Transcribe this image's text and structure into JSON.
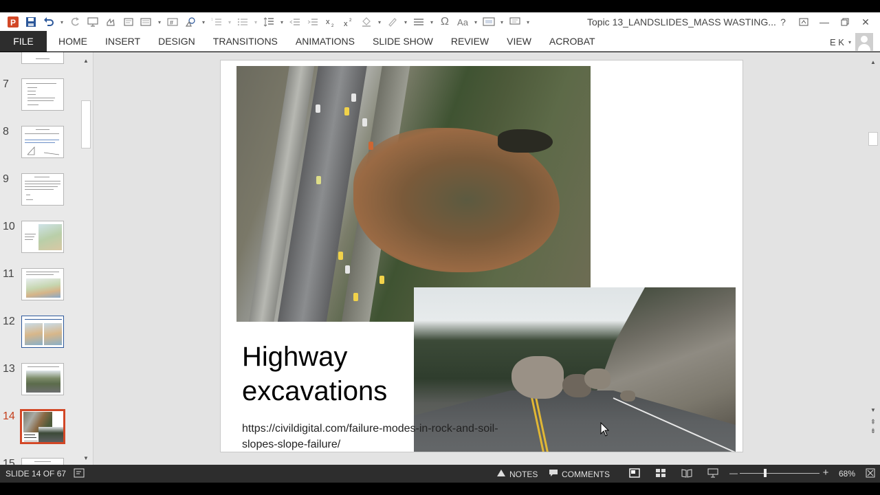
{
  "titlebar": {
    "doc_title": "Topic 13_LANDSLIDES_MASS WASTING...",
    "app_icon": "powerpoint-icon",
    "colors": {
      "app_accent": "#d24726"
    }
  },
  "ribbon": {
    "file_label": "FILE",
    "tabs": [
      "HOME",
      "INSERT",
      "DESIGN",
      "TRANSITIONS",
      "ANIMATIONS",
      "SLIDE SHOW",
      "REVIEW",
      "VIEW",
      "ACROBAT"
    ],
    "user_initials": "E K"
  },
  "thumbnails": {
    "numbers": [
      "7",
      "8",
      "9",
      "10",
      "11",
      "12",
      "13",
      "14",
      "15"
    ],
    "active": "14"
  },
  "slide": {
    "title": "Highway excavations",
    "link": "https://civildigital.com/failure-modes-in-rock-and-soil-slopes-slope-failure/"
  },
  "status": {
    "slide_counter": "SLIDE 14 OF 67",
    "notes_label": "NOTES",
    "comments_label": "COMMENTS",
    "zoom": "68%",
    "zoom_fraction": 0.32
  }
}
